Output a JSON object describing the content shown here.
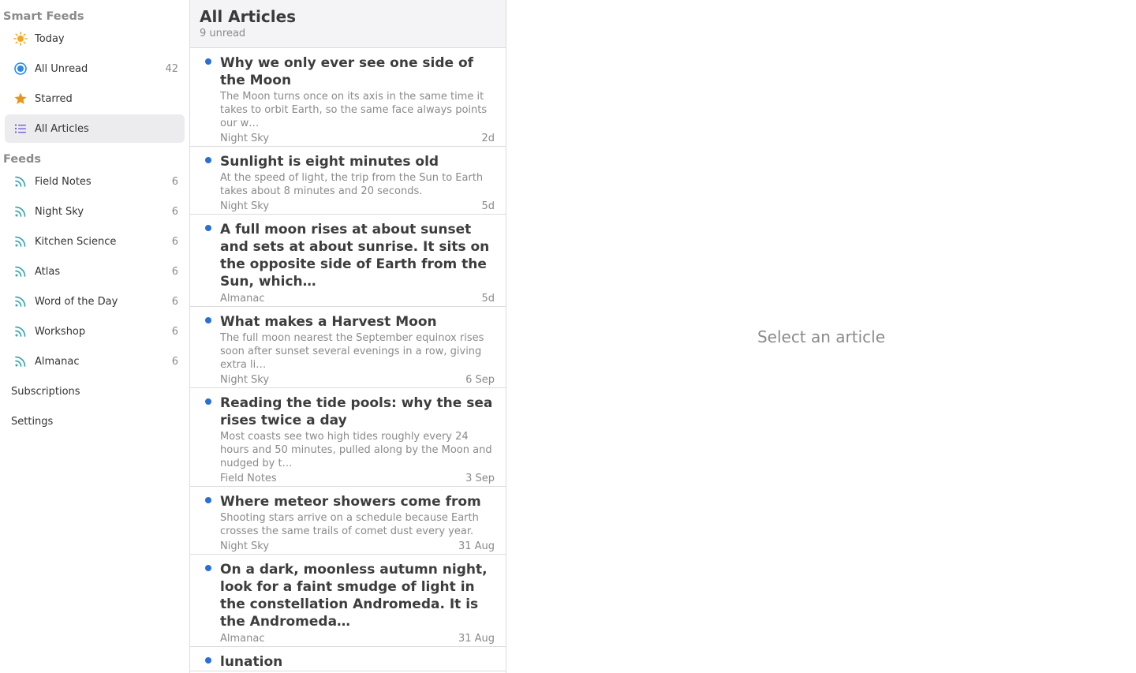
{
  "sidebar": {
    "smart_title": "Smart Feeds",
    "smart": [
      {
        "label": "Today",
        "count": "",
        "icon": "sun-icon"
      },
      {
        "label": "All Unread",
        "count": "42",
        "icon": "unread-circle-icon"
      },
      {
        "label": "Starred",
        "count": "",
        "icon": "star-icon"
      },
      {
        "label": "All Articles",
        "count": "",
        "icon": "list-icon"
      }
    ],
    "feeds_title": "Feeds",
    "feeds": [
      {
        "label": "Field Notes",
        "count": "6"
      },
      {
        "label": "Night Sky",
        "count": "6"
      },
      {
        "label": "Kitchen Science",
        "count": "6"
      },
      {
        "label": "Atlas",
        "count": "6"
      },
      {
        "label": "Word of the Day",
        "count": "6"
      },
      {
        "label": "Workshop",
        "count": "6"
      },
      {
        "label": "Almanac",
        "count": "6"
      }
    ],
    "subscriptions_label": "Subscriptions",
    "settings_label": "Settings"
  },
  "list": {
    "title": "All Articles",
    "subtitle": "9 unread",
    "articles": [
      {
        "title": "Why we only ever see one side of the Moon",
        "snippet": "The Moon turns once on its axis in the same time it takes to orbit Earth, so the same face always points our w…",
        "feed": "Night Sky",
        "date": "2d"
      },
      {
        "title": "Sunlight is eight minutes old",
        "snippet": "At the speed of light, the trip from the Sun to Earth takes about 8 minutes and 20 seconds.",
        "feed": "Night Sky",
        "date": "5d"
      },
      {
        "title": "A full moon rises at about sunset and sets at about sunrise. It sits on the opposite side of Earth from the Sun, which…",
        "snippet": "",
        "feed": "Almanac",
        "date": "5d"
      },
      {
        "title": "What makes a Harvest Moon",
        "snippet": "The full moon nearest the September equinox rises soon after sunset several evenings in a row, giving extra li…",
        "feed": "Night Sky",
        "date": "6 Sep"
      },
      {
        "title": "Reading the tide pools: why the sea rises twice a day",
        "snippet": "Most coasts see two high tides roughly every 24 hours and 50 minutes, pulled along by the Moon and nudged by t…",
        "feed": "Field Notes",
        "date": "3 Sep"
      },
      {
        "title": "Where meteor showers come from",
        "snippet": "Shooting stars arrive on a schedule because Earth crosses the same trails of comet dust every year.",
        "feed": "Night Sky",
        "date": "31 Aug"
      },
      {
        "title": "On a dark, moonless autumn night, look for a faint smudge of light in the constellation Andromeda. It is the Andromeda…",
        "snippet": "",
        "feed": "Almanac",
        "date": "31 Aug"
      },
      {
        "title": "lunation",
        "snippet": "",
        "feed": "",
        "date": ""
      }
    ]
  },
  "reader": {
    "empty_text": "Select an article"
  },
  "colors": {
    "accent": "#2a6fd6",
    "sun": "#f5a623",
    "star": "#e8951c",
    "list_icon": "#6b5bd6",
    "feed_icon": "#3ba7b0"
  }
}
